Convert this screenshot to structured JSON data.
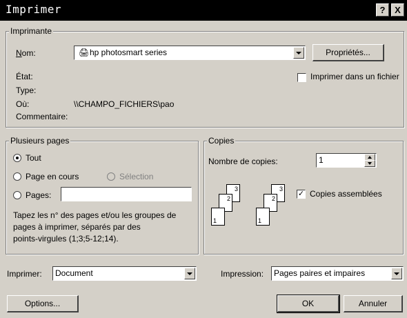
{
  "window": {
    "title": "Imprimer",
    "help_label": "?",
    "close_label": "X"
  },
  "printer": {
    "group_title": "Imprimante",
    "name_label": "Nom:",
    "name_value": "hp photosmart series",
    "properties_label": "Propriétés...",
    "print_to_file_label": "Imprimer dans un fichier",
    "print_to_file_checked": false,
    "state_label": "État:",
    "type_label": "Type:",
    "where_label": "Où:",
    "where_value": "\\\\CHAMPO_FICHIERS\\pao",
    "comment_label": "Commentaire:"
  },
  "page_range": {
    "group_title": "Plusieurs pages",
    "all_label": "Tout",
    "current_label": "Page en cours",
    "selection_label": "Sélection",
    "pages_label": "Pages:",
    "pages_value": "",
    "selected": "all",
    "help_line1": "Tapez les n° des pages et/ou les groupes de",
    "help_line2": "pages à imprimer, séparés par des",
    "help_line3": "points-virgules (1;3;5-12;14)."
  },
  "copies": {
    "group_title": "Copies",
    "count_label": "Nombre de copies:",
    "count_value": "1",
    "collate_label": "Copies assemblées",
    "collate_checked": true,
    "stack_numbers": [
      "1",
      "2",
      "3"
    ]
  },
  "bottom": {
    "print_what_label": "Imprimer:",
    "print_what_value": "Document",
    "print_label": "Impression:",
    "print_value": "Pages paires et impaires",
    "options_label": "Options...",
    "ok_label": "OK",
    "cancel_label": "Annuler"
  },
  "colors": {
    "face": "#d4d0c8",
    "titlebar": "#000000",
    "disabled": "#808080"
  }
}
